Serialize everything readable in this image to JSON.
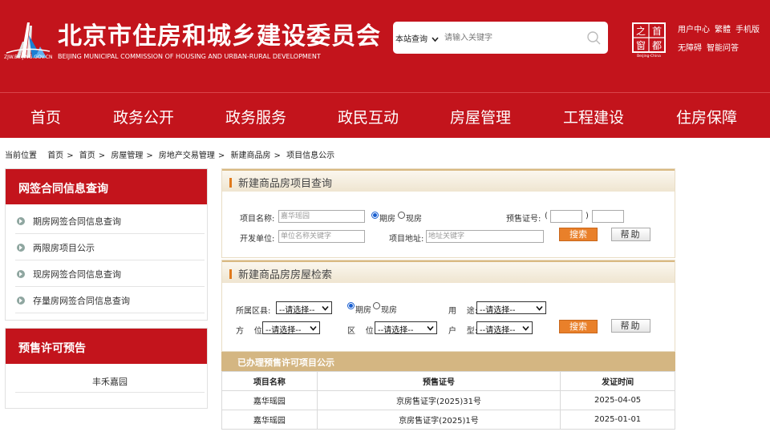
{
  "header": {
    "site_name": "北京市住房和城乡建设委员会",
    "site_name_en": "BEIJING MUNICIPAL COMMISSION OF HOUSING AND URBAN-RURAL DEVELOPMENT",
    "domain": "ZJW.BEIJING.GOV.CN",
    "search_scope": "本站查询",
    "search_placeholder": "请输入关键字",
    "badge_chars": [
      "之",
      "首",
      "都",
      "窗"
    ],
    "badge_text_en": "Beijing-China",
    "links_row1": [
      "用户中心",
      "繁體",
      "手机版"
    ],
    "links_row2": [
      "无障碍",
      "智能问答"
    ]
  },
  "nav": {
    "items": [
      "首页",
      "政务公开",
      "政务服务",
      "政民互动",
      "房屋管理",
      "工程建设",
      "住房保障"
    ]
  },
  "breadcrumb": {
    "prefix": "当前位置",
    "items": [
      "首页",
      "首页",
      "房屋管理",
      "房地产交易管理",
      "新建商品房",
      "项目信息公示"
    ],
    "separator": ">"
  },
  "sidebar": {
    "section1_title": "网签合同信息查询",
    "items": [
      "期房网签合同信息查询",
      "两限房项目公示",
      "现房网签合同信息查询",
      "存量房网签合同信息查询"
    ],
    "section2_title": "预售许可预告",
    "presale_items": [
      "丰禾嘉园"
    ]
  },
  "project_query": {
    "title": "新建商品房项目查询",
    "project_name_label": "项目名称:",
    "project_name_placeholder": "嘉华瑶园",
    "radio_options": [
      "期房",
      "现房"
    ],
    "radio_selected": "期房",
    "presale_cert_label": "预售证号:",
    "paren_open": "(",
    "paren_close": ")",
    "developer_label": "开发单位:",
    "developer_placeholder": "单位名称关键字",
    "address_label": "项目地址:",
    "address_placeholder": "地址关键字",
    "search_btn": "搜索",
    "help_btn": "帮助"
  },
  "house_search": {
    "title": "新建商品房房屋检索",
    "district_label": "所属区县:",
    "district_value": "--请选择--",
    "radio_options": [
      "期房",
      "现房"
    ],
    "radio_selected": "期房",
    "usage_label": "用    途:",
    "usage_value": "--请选择--",
    "orientation_label": "方    位:",
    "orientation_value": "--请选择--",
    "location_label": "区    位:",
    "location_value": "--请选择--",
    "layout_label": "户    型:",
    "layout_value": "--请选择--",
    "search_btn": "搜索",
    "help_btn": "帮助"
  },
  "permit_table": {
    "title": "已办理预售许可项目公示",
    "columns": [
      "项目名称",
      "预售证号",
      "发证时间"
    ],
    "rows": [
      [
        "嘉华瑶园",
        "京房售证字(2025)31号",
        "2025-04-05"
      ],
      [
        "嘉华瑶园",
        "京房售证字(2025)1号",
        "2025-01-01"
      ]
    ]
  },
  "colors": {
    "brand_red": "#c3141c",
    "accent_orange": "#e9802a",
    "table_bar": "#d4b682"
  }
}
